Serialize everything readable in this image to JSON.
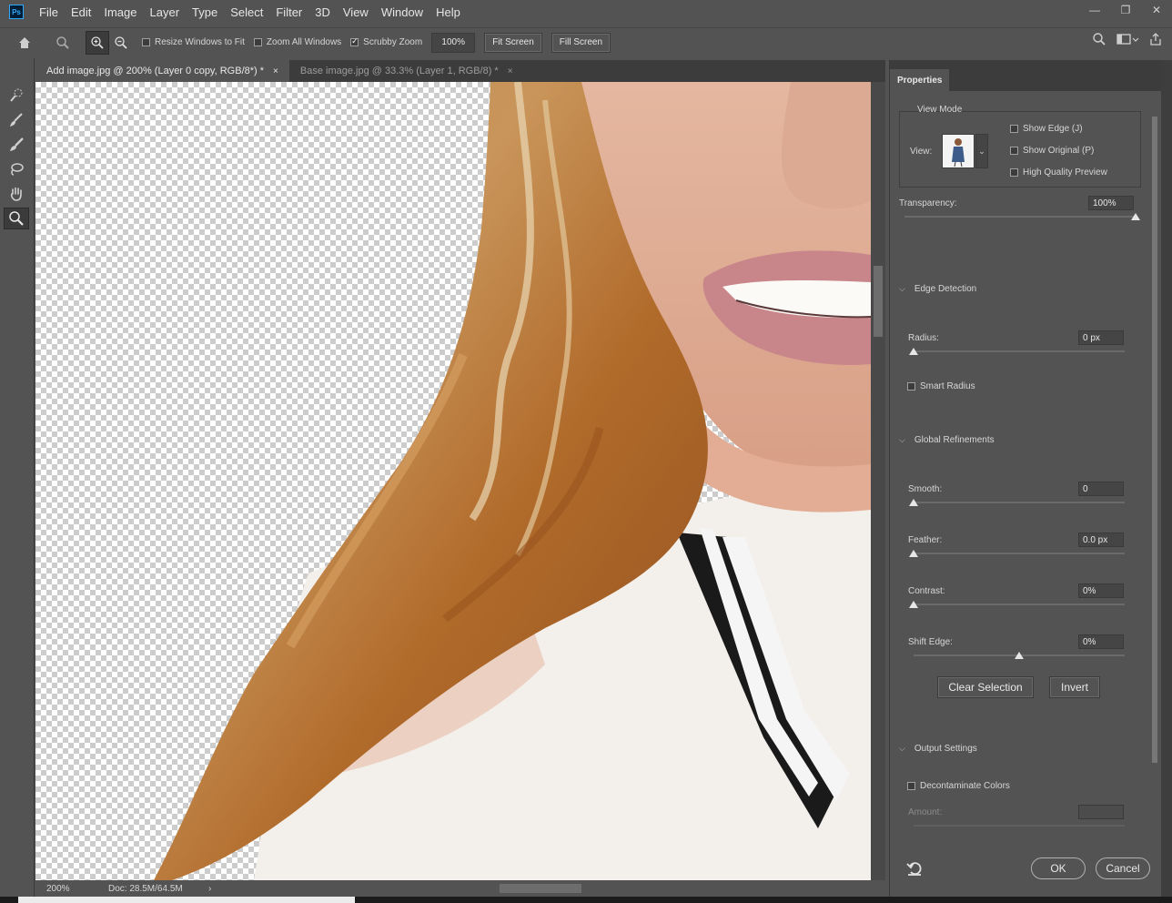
{
  "menubar": {
    "logo": "Ps",
    "items": [
      "File",
      "Edit",
      "Image",
      "Layer",
      "Type",
      "Select",
      "Filter",
      "3D",
      "View",
      "Window",
      "Help"
    ]
  },
  "options": {
    "resize_windows": "Resize Windows to Fit",
    "zoom_all_windows": "Zoom All Windows",
    "scrubby_zoom": "Scrubby Zoom",
    "zoom_value": "100%",
    "fit_screen": "Fit Screen",
    "fill_screen": "Fill Screen"
  },
  "tabs": [
    {
      "label": "Add image.jpg @ 200% (Layer 0 copy, RGB/8*) *",
      "close": "×"
    },
    {
      "label": "Base image.jpg @ 33.3% (Layer 1, RGB/8) *",
      "close": "×"
    }
  ],
  "status": {
    "zoom": "200%",
    "doc": "Doc: 28.5M/64.5M",
    "arrow": "›"
  },
  "properties": {
    "tab": "Properties",
    "view_mode": "View Mode",
    "view_label": "View:",
    "show_edge": "Show Edge (J)",
    "show_original": "Show Original (P)",
    "high_quality": "High Quality Preview",
    "transparency_label": "Transparency:",
    "transparency_value": "100%",
    "edge_detection": "Edge Detection",
    "radius_label": "Radius:",
    "radius_value": "0 px",
    "smart_radius": "Smart Radius",
    "global_refinements": "Global Refinements",
    "smooth_label": "Smooth:",
    "smooth_value": "0",
    "feather_label": "Feather:",
    "feather_value": "0.0 px",
    "contrast_label": "Contrast:",
    "contrast_value": "0%",
    "shift_edge_label": "Shift Edge:",
    "shift_edge_value": "0%",
    "clear_selection": "Clear Selection",
    "invert": "Invert",
    "output_settings": "Output Settings",
    "decontaminate": "Decontaminate Colors",
    "amount_label": "Amount:",
    "ok": "OK",
    "cancel": "Cancel"
  },
  "sliders": {
    "transparency": 1.0,
    "radius": 0.0,
    "smooth": 0.0,
    "feather": 0.0,
    "contrast": 0.0,
    "shift_edge": 0.5
  },
  "colors": {
    "panel": "#535353",
    "dark": "#3c3c3c",
    "brand": "#31a8ff"
  }
}
